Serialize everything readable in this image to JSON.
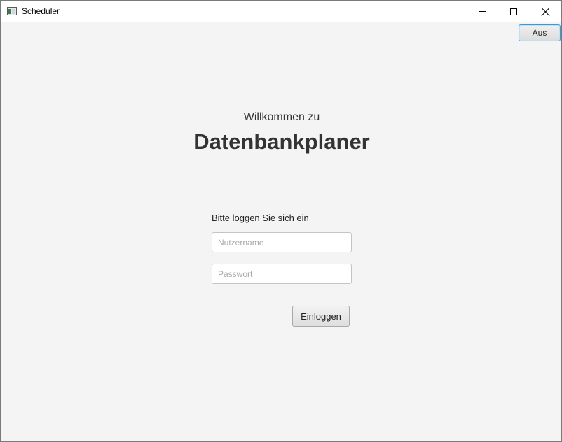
{
  "window": {
    "title": "Scheduler",
    "icon": "app-window-icon",
    "controls": [
      "minimize-icon",
      "maximize-icon",
      "close-icon"
    ]
  },
  "header": {
    "logout_label": "Aus"
  },
  "main": {
    "welcome": "Willkommen zu",
    "app_name": "Datenbankplaner",
    "login_prompt": "Bitte loggen Sie sich ein",
    "username": {
      "value": "",
      "placeholder": "Nutzername"
    },
    "password": {
      "value": "",
      "placeholder": "Passwort"
    },
    "login_label": "Einloggen"
  },
  "colors": {
    "background": "#f4f4f4",
    "focus_border": "#3a9ad9",
    "text": "#333333"
  }
}
